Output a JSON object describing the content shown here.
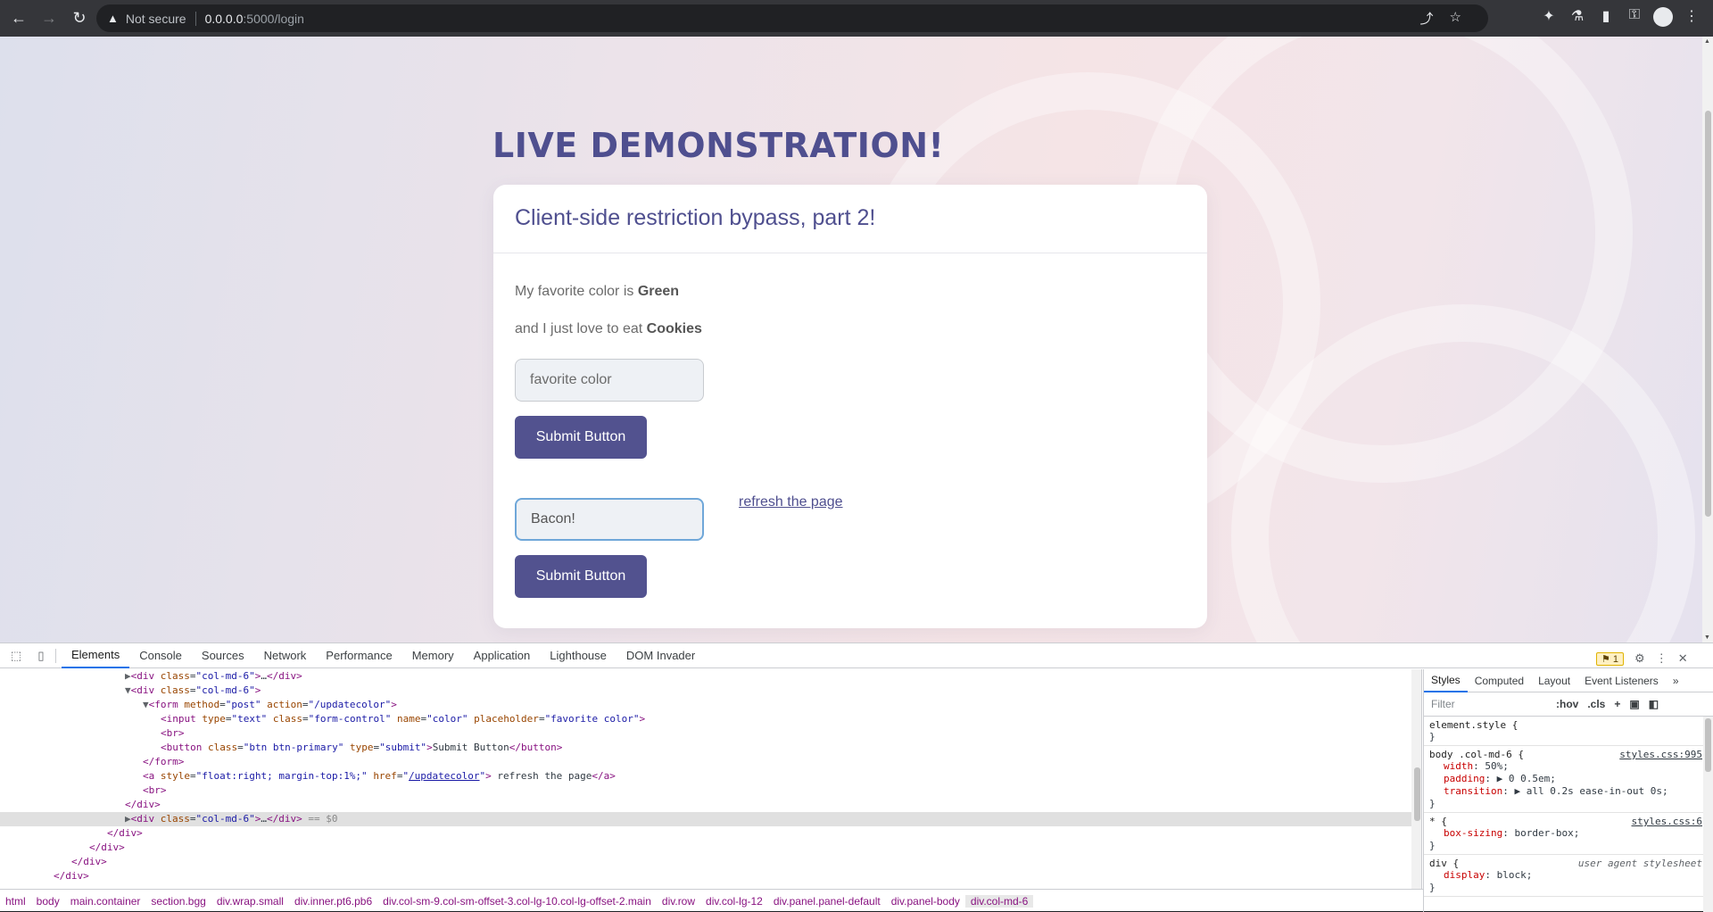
{
  "browser": {
    "security_label": "Not secure",
    "url_host": "0.0.0.0",
    "url_path": ":5000/login"
  },
  "page": {
    "heading": "LIVE DEMONSTRATION!",
    "panel_title": "Client-side restriction bypass, part 2!",
    "color_prefix": "My favorite color is ",
    "color_value": "Green",
    "food_prefix": "and I just love to eat ",
    "food_value": "Cookies",
    "color_input": {
      "placeholder": "favorite color",
      "value": ""
    },
    "submit_label": "Submit Button",
    "refresh_link": "refresh the page",
    "food_input": {
      "value": "Bacon!"
    },
    "submit2_label": "Submit Button"
  },
  "devtools": {
    "tabs": [
      "Elements",
      "Console",
      "Sources",
      "Network",
      "Performance",
      "Memory",
      "Application",
      "Lighthouse",
      "DOM Invader"
    ],
    "issues_count": "1",
    "dom_lines": [
      {
        "indent": 6,
        "html": "<span class='tri'>▶</span><span class='tag'>&lt;div</span> <span class='att'>class</span>=<span class='val'>\"col-md-6\"</span><span class='tag'>&gt;</span>…<span class='tag'>&lt;/div&gt;</span>"
      },
      {
        "indent": 6,
        "html": "<span class='tri'>▼</span><span class='tag'>&lt;div</span> <span class='att'>class</span>=<span class='val'>\"col-md-6\"</span><span class='tag'>&gt;</span>"
      },
      {
        "indent": 7,
        "html": "<span class='tri'>▼</span><span class='tag'>&lt;form</span> <span class='att'>method</span>=<span class='val'>\"post\"</span> <span class='att'>action</span>=<span class='val'>\"/updatecolor\"</span><span class='tag'>&gt;</span>"
      },
      {
        "indent": 8,
        "html": "<span class='tag'>&lt;input</span> <span class='att'>type</span>=<span class='val'>\"text\"</span> <span class='att'>class</span>=<span class='val'>\"form-control\"</span> <span class='att'>name</span>=<span class='val'>\"color\"</span> <span class='att'>placeholder</span>=<span class='val'>\"favorite color\"</span><span class='tag'>&gt;</span>"
      },
      {
        "indent": 8,
        "html": "<span class='tag'>&lt;br&gt;</span>"
      },
      {
        "indent": 8,
        "html": "<span class='tag'>&lt;button</span> <span class='att'>class</span>=<span class='val'>\"btn btn-primary\"</span> <span class='att'>type</span>=<span class='val'>\"submit\"</span><span class='tag'>&gt;</span>Submit Button<span class='tag'>&lt;/button&gt;</span>"
      },
      {
        "indent": 7,
        "html": "<span class='tag'>&lt;/form&gt;</span>"
      },
      {
        "indent": 7,
        "html": "<span class='tag'>&lt;a</span> <span class='att'>style</span>=<span class='val'>\"float:right; margin-top:1%;\"</span> <span class='att'>href</span>=<span class='val'>\"<span class='link'>/updatecolor</span>\"</span><span class='tag'>&gt;</span> refresh the page<span class='tag'>&lt;/a&gt;</span>"
      },
      {
        "indent": 7,
        "html": "<span class='tag'>&lt;br&gt;</span>"
      },
      {
        "indent": 6,
        "html": "<span class='tag'>&lt;/div&gt;</span>"
      },
      {
        "indent": 6,
        "sel": true,
        "html": "<span class='tri'>▶</span><span class='tag'>&lt;div</span> <span class='att'>class</span>=<span class='val'>\"col-md-6\"</span><span class='tag'>&gt;</span>…<span class='tag'>&lt;/div&gt;</span> <span style='color:#888'>== $0</span>"
      },
      {
        "indent": 5,
        "html": "<span class='tag'>&lt;/div&gt;</span>"
      },
      {
        "indent": 4,
        "html": "<span class='tag'>&lt;/div&gt;</span>"
      },
      {
        "indent": 3,
        "html": "<span class='tag'>&lt;/div&gt;</span>"
      },
      {
        "indent": 2,
        "html": "<span class='tag'>&lt;/div&gt;</span>"
      }
    ],
    "breadcrumbs": [
      "html",
      "body",
      "main.container",
      "section.bgg",
      "div.wrap.small",
      "div.inner.pt6.pb6",
      "div.col-sm-9.col-sm-offset-3.col-lg-10.col-lg-offset-2.main",
      "div.row",
      "div.col-lg-12",
      "div.panel.panel-default",
      "div.panel-body",
      "div.col-md-6"
    ],
    "styles_tabs": [
      "Styles",
      "Computed",
      "Layout",
      "Event Listeners"
    ],
    "filter_placeholder": "Filter",
    "hov": ":hov",
    "cls": ".cls",
    "rules": [
      {
        "selector": "element.style {",
        "source": "",
        "props": []
      },
      {
        "selector": "body .col-md-6 {",
        "source": "styles.css:995",
        "props": [
          [
            "width",
            "50%;"
          ],
          [
            "padding",
            "▶ 0 0.5em;"
          ],
          [
            "transition",
            "▶ all 0.2s ease-in-out 0s;"
          ]
        ]
      },
      {
        "selector": "* {",
        "source": "styles.css:6",
        "props": [
          [
            "box-sizing",
            "border-box;"
          ]
        ]
      },
      {
        "selector": "div {",
        "ua": "user agent stylesheet",
        "props": [
          [
            "display",
            "block;"
          ]
        ]
      }
    ]
  }
}
